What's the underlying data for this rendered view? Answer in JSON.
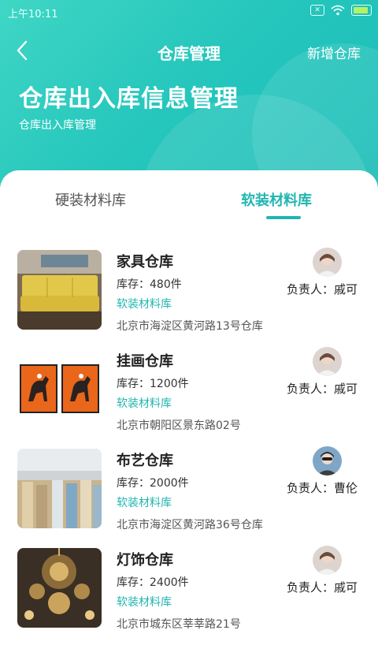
{
  "status_bar": {
    "time": "上午10:11"
  },
  "nav": {
    "title": "仓库管理",
    "action": "新增仓库"
  },
  "header": {
    "title": "仓库出入库信息管理",
    "subtitle": "仓库出入库管理"
  },
  "tabs": [
    {
      "label": "硬装材料库"
    },
    {
      "label": "软装材料库",
      "active": true
    }
  ],
  "warehouses": [
    {
      "name": "家具仓库",
      "stock": "库存：480件",
      "category": "软装材料库",
      "address": "北京市海淀区黄河路13号仓库",
      "owner": "负责人：戚可",
      "thumb_icon": "sofa-photo"
    },
    {
      "name": "挂画仓库",
      "stock": "库存：1200件",
      "category": "软装材料库",
      "address": "北京市朝阳区景东路02号",
      "owner": "负责人：戚可",
      "thumb_icon": "horse-paintings-photo"
    },
    {
      "name": "布艺仓库",
      "stock": "库存：2000件",
      "category": "软装材料库",
      "address": "北京市海淀区黄河路36号仓库",
      "owner": "负责人：曹伦",
      "thumb_icon": "fabric-rolls-photo"
    },
    {
      "name": "灯饰仓库",
      "stock": "库存：2400件",
      "category": "软装材料库",
      "address": "北京市城东区莘莘路21号",
      "owner": "负责人：戚可",
      "thumb_icon": "chandelier-photo"
    }
  ],
  "colors": {
    "accent": "#22b5b0",
    "header_gradient_start": "#3fd6c5",
    "header_gradient_end": "#18bcb6"
  }
}
